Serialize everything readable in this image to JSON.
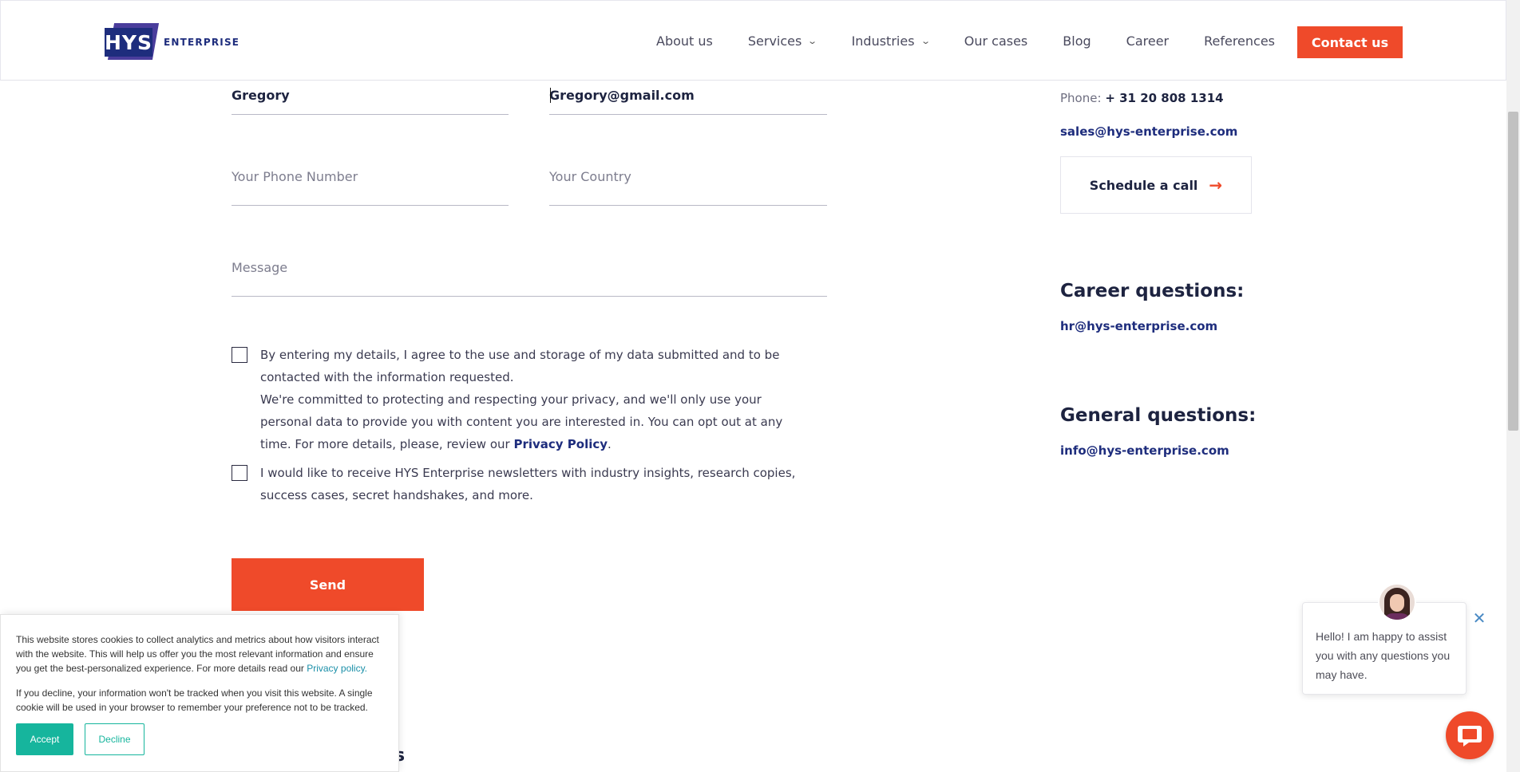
{
  "header": {
    "logo_mark": "HYS",
    "logo_word": "ENTERPRISE",
    "nav": [
      {
        "label": "About us",
        "has_dropdown": false
      },
      {
        "label": "Services",
        "has_dropdown": true
      },
      {
        "label": "Industries",
        "has_dropdown": true
      },
      {
        "label": "Our cases",
        "has_dropdown": false
      },
      {
        "label": "Blog",
        "has_dropdown": false
      },
      {
        "label": "Career",
        "has_dropdown": false
      },
      {
        "label": "References",
        "has_dropdown": false
      }
    ],
    "contact_button": "Contact us"
  },
  "form": {
    "name_value": "Gregory",
    "email_value": "Gregory@gmail.com",
    "phone_placeholder": "Your Phone Number",
    "country_placeholder": "Your Country",
    "message_placeholder": "Message",
    "consent_text_1": "By entering my details, I agree to the use and storage of my data submitted and to be contacted with the information requested.",
    "consent_text_2": "We're committed to protecting and respecting your privacy, and we'll only use your personal data to provide you with content you are interested in. You can opt out at any time. For more details, please, review our",
    "privacy_link": "Privacy Policy",
    "newsletter_text": "I would like to receive HYS Enterprise newsletters with industry insights, research copies, success cases, secret handshakes, and more.",
    "consent_checked": false,
    "newsletter_checked": false,
    "send_button": "Send"
  },
  "contact": {
    "phone_label": "Phone:",
    "phone_number": "+ 31 20 808 1314",
    "sales_email": "sales@hys-enterprise.com",
    "schedule_button": "Schedule a call",
    "career_heading": "Career questions:",
    "career_email": "hr@hys-enterprise.com",
    "general_heading": "General questions:",
    "general_email": "info@hys-enterprise.com"
  },
  "cookie_banner": {
    "text_1": "This website stores cookies to collect analytics and metrics about how visitors interact with the website. This will help us offer you the most relevant information and ensure you get the best-personalized experience. For more details read our",
    "privacy_link": "Privacy policy.",
    "text_2": "If you decline, your information won't be tracked when you visit this website. A single cookie will be used in your browser to remember your preference not to be tracked.",
    "accept": "Accept",
    "decline": "Decline"
  },
  "peek_text": "s",
  "chat": {
    "message": "Hello! I am happy to assist you with any questions you may have."
  },
  "colors": {
    "brand_orange": "#ef4a2a",
    "brand_navy": "#1e2d7d",
    "cookie_teal": "#16b59d"
  },
  "icons": {
    "dropdown": "chevron-down-icon",
    "schedule_arrow": "arrow-right-icon",
    "chat_close": "close-icon",
    "chat_launcher": "chat-bubble-icon"
  }
}
